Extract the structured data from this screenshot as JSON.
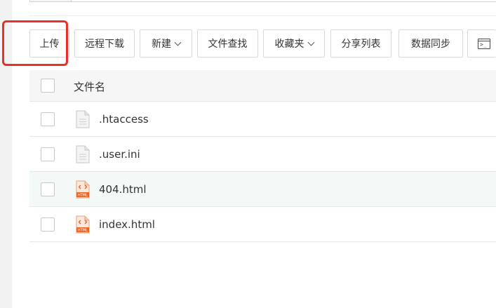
{
  "toolbar": {
    "upload_label": "上传",
    "remote_download_label": "远程下载",
    "new_label": "新建",
    "file_search_label": "文件查找",
    "favorites_label": "收藏夹",
    "share_list_label": "分享列表",
    "data_sync_label": "数据同步",
    "terminal_glyph": ">_"
  },
  "table": {
    "header_name": "文件名",
    "files": [
      {
        "name": ".htaccess",
        "icon": "text-file-icon",
        "type_tag": ""
      },
      {
        "name": ".user.ini",
        "icon": "text-file-icon",
        "type_tag": ""
      },
      {
        "name": "404.html",
        "icon": "html-file-icon",
        "type_tag": "HTML"
      },
      {
        "name": "index.html",
        "icon": "html-file-icon",
        "type_tag": "HTML"
      }
    ]
  },
  "colors": {
    "highlight": "#e8312b",
    "html_icon": "#e8662a",
    "hover_row": "#f2f9f7"
  }
}
